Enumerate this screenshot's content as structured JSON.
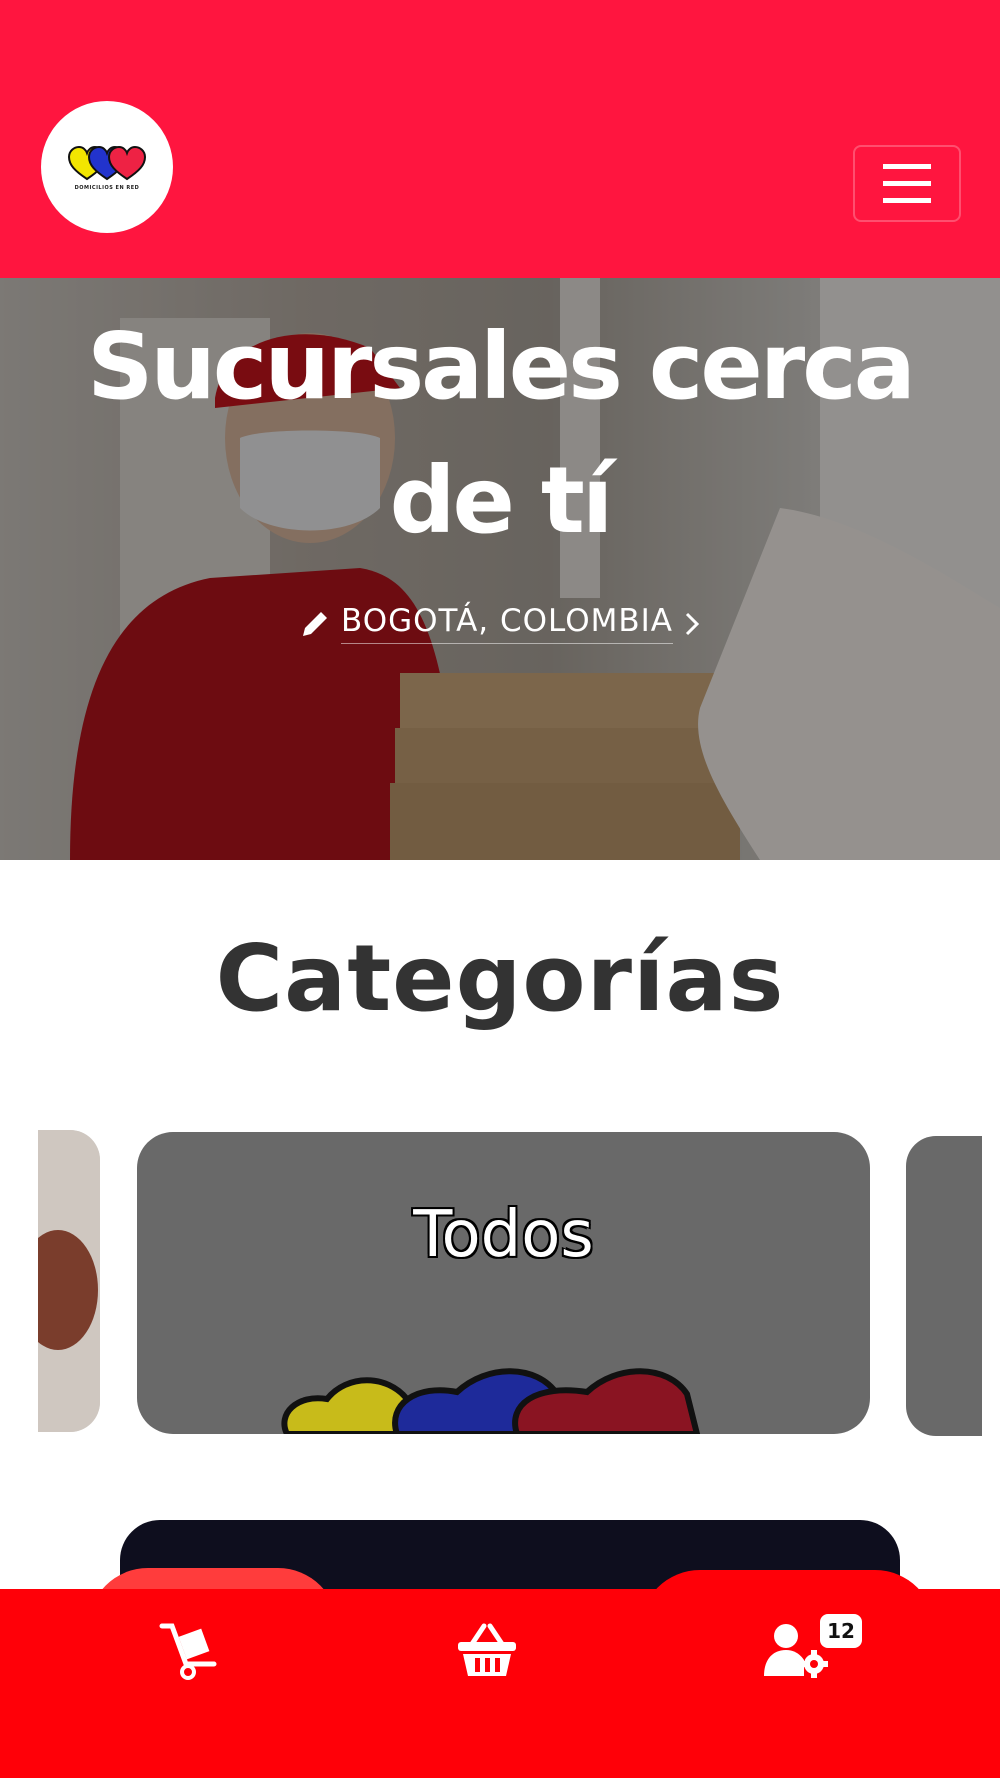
{
  "header": {
    "logo_caption": "DOMICILIOS EN RED",
    "menu_icon": "hamburger-menu-icon"
  },
  "hero": {
    "title": "Sucursales cerca de tí",
    "location": "BOGOTÁ, COLOMBIA",
    "edit_icon": "pencil-icon",
    "chevron_icon": "chevron-right-icon"
  },
  "categories": {
    "title": "Categorías",
    "items": [
      {
        "label": "Todos"
      }
    ]
  },
  "bottom_nav": {
    "items": [
      {
        "icon": "hand-truck-icon"
      },
      {
        "icon": "basket-icon"
      },
      {
        "icon": "user-settings-icon",
        "badge": "12"
      }
    ]
  },
  "colors": {
    "header_red": "#ff153f",
    "nav_red": "#ff0008",
    "card_gray": "#696969",
    "title_dark": "#333333"
  }
}
